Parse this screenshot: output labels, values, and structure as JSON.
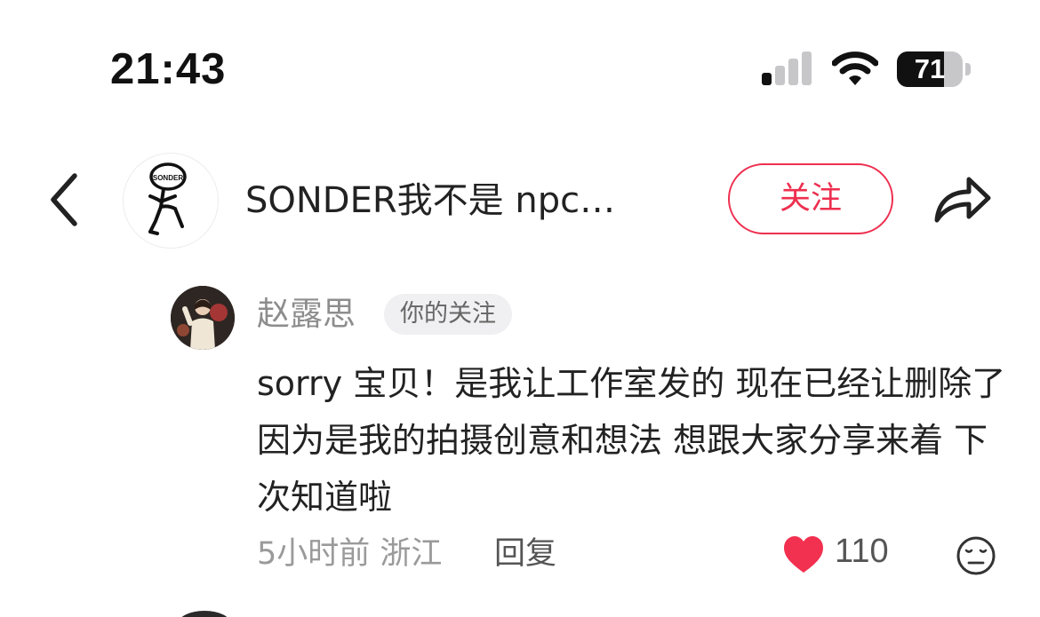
{
  "status_bar": {
    "time": "21:43",
    "signal_bars_active": 1,
    "signal_bars_total": 4,
    "battery_level": "71",
    "battery_fraction": 0.71,
    "signal_icon": "cellular-signal-icon",
    "wifi_icon": "wifi-icon",
    "battery_icon": "battery-icon"
  },
  "header": {
    "back_icon": "chevron-left-icon",
    "title": "SONDER我不是 npc…",
    "avatar_text": "SONDER",
    "follow_label": "关注",
    "share_icon": "share-arrow-icon"
  },
  "comment": {
    "author": "赵露思",
    "badge": "你的关注",
    "text": "sorry 宝贝！是我让工作室发的 现在已经让删除了 因为是我的拍摄创意和想法 想跟大家分享来着 下次知道啦",
    "time_location": "5小时前 浙江",
    "reply_label": "回复",
    "like_count": "110",
    "like_icon": "heart-icon",
    "emoji_icon": "emoji-face-icon"
  },
  "colors": {
    "accent": "#ee2f4f",
    "heart": "#f2304f",
    "muted_text": "#9a9a9a",
    "badge_bg": "#f0f0f2"
  }
}
